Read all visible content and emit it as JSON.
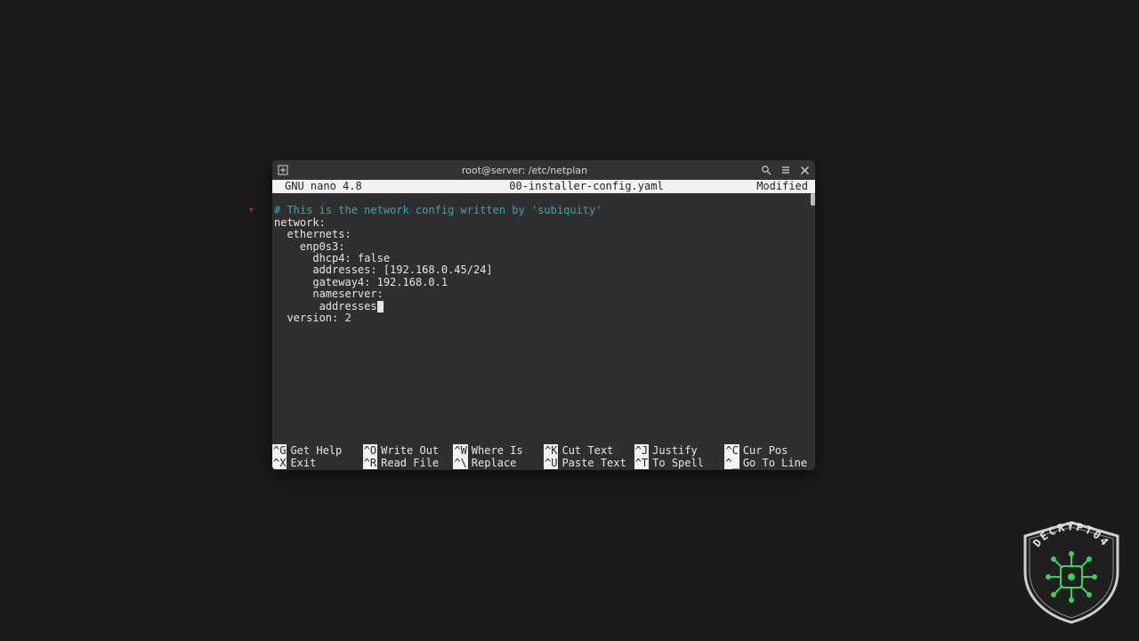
{
  "window_title": "root@server: /etc/netplan",
  "nano": {
    "version_label": "GNU nano 4.8",
    "filename": "00-installer-config.yaml",
    "status": "Modified",
    "comment": "# This is the network config written by 'subiquity'",
    "lines": {
      "l1": "network:",
      "l2": "  ethernets:",
      "l3": "    enp0s3:",
      "l4": "      dhcp4: false",
      "l5": "      addresses: [192.168.0.45/24]",
      "l6": "      gateway4: 192.168.0.1",
      "l7": "      nameserver:",
      "l8_before_cursor": "       addresses",
      "l9": "  version: 2"
    },
    "shortcuts": {
      "r1": [
        {
          "key": "^G",
          "label": "Get Help"
        },
        {
          "key": "^O",
          "label": "Write Out"
        },
        {
          "key": "^W",
          "label": "Where Is"
        },
        {
          "key": "^K",
          "label": "Cut Text"
        },
        {
          "key": "^J",
          "label": "Justify"
        },
        {
          "key": "^C",
          "label": "Cur Pos"
        }
      ],
      "r2": [
        {
          "key": "^X",
          "label": "Exit"
        },
        {
          "key": "^R",
          "label": "Read File"
        },
        {
          "key": "^\\",
          "label": "Replace"
        },
        {
          "key": "^U",
          "label": "Paste Text"
        },
        {
          "key": "^T",
          "label": "To Spell"
        },
        {
          "key": "^_",
          "label": "Go To Line"
        }
      ]
    }
  },
  "logo_text": "DECRYPT04",
  "red_glyph": "▾",
  "colors": {
    "desktop_bg": "#1b1b1b",
    "term_bg": "#2e2f31",
    "inverse_bg": "#f2f2f2",
    "comment": "#3aa6a6",
    "logo_accent": "#35d461"
  }
}
